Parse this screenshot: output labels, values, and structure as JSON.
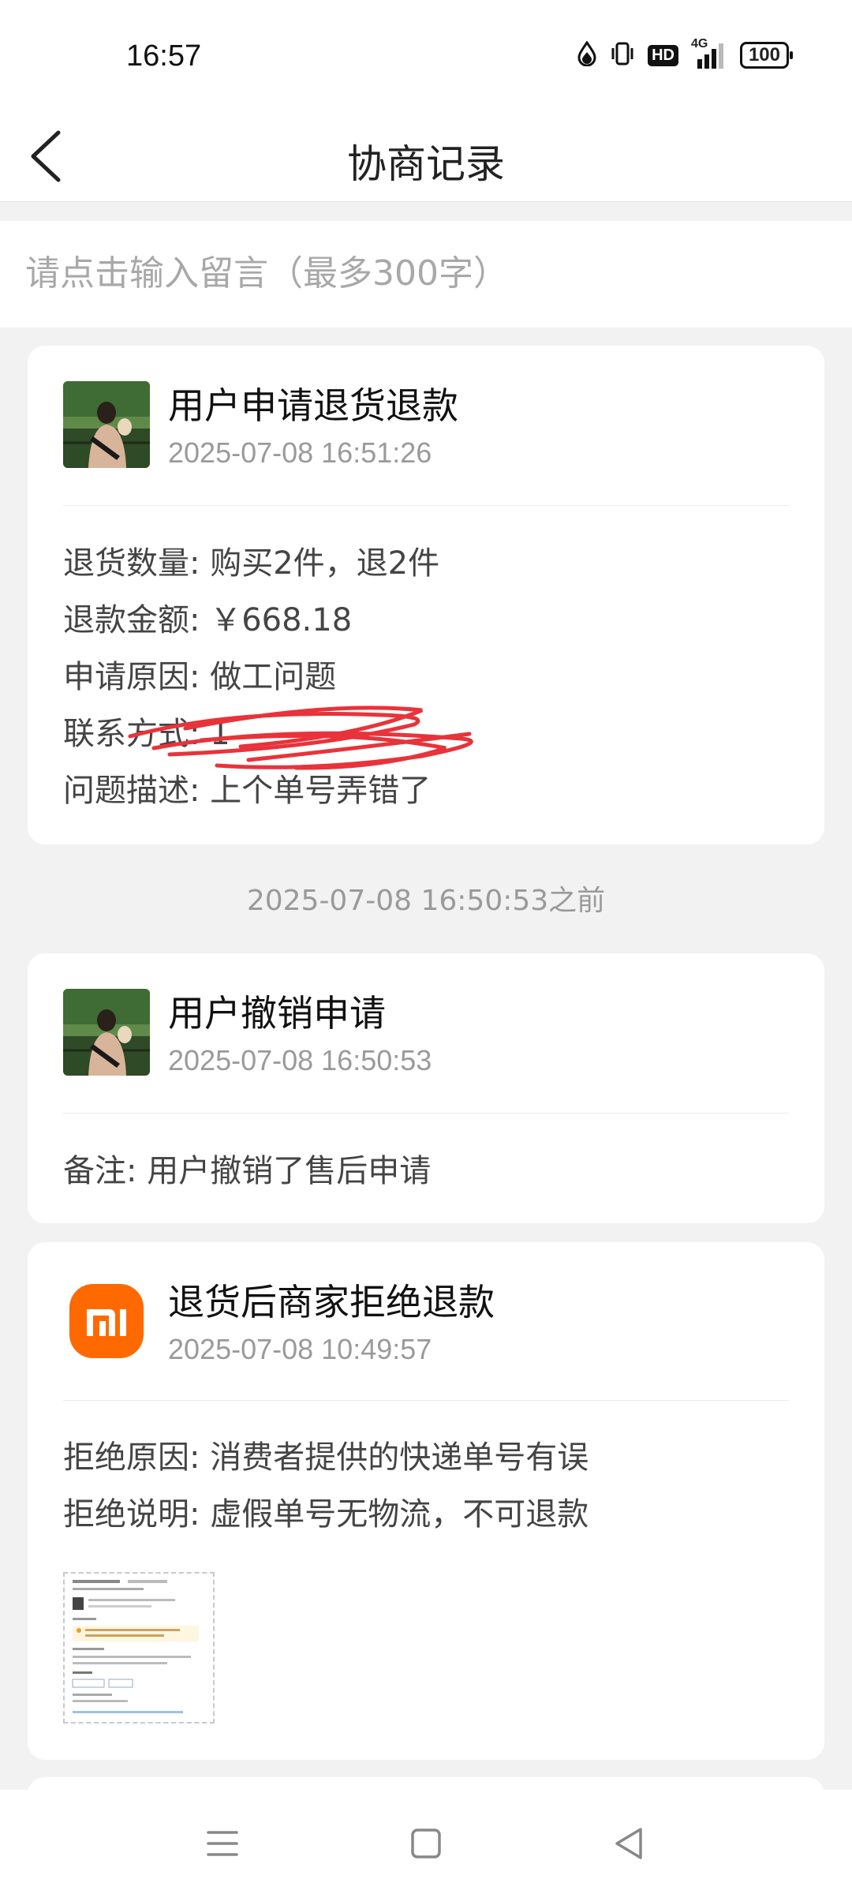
{
  "status_bar": {
    "time": "16:57",
    "network": "4G",
    "hd_label": "HD",
    "battery": "100",
    "icons": [
      "water-drop-icon",
      "vibrate-icon",
      "hd-icon",
      "signal-icon",
      "battery-icon"
    ]
  },
  "header": {
    "title": "协商记录",
    "back_icon": "back-arrow-icon"
  },
  "message_input": {
    "placeholder": "请点击输入留言（最多300字）"
  },
  "records": [
    {
      "title": "用户申请退货退款",
      "time": "2025-07-08 16:51:26",
      "avatar": "user-avatar",
      "fields": [
        "退货数量: 购买2件，退2件",
        "退款金额: ￥668.18",
        "申请原因: 做工问题",
        "联系方式: 1",
        "问题描述: 上个单号弄错了"
      ],
      "redaction": "red-scribble"
    },
    {
      "title": "用户撤销申请",
      "time": "2025-07-08 16:50:53",
      "avatar": "user-avatar",
      "fields": [
        "备注: 用户撤销了售后申请"
      ]
    },
    {
      "title": "退货后商家拒绝退款",
      "time": "2025-07-08 10:49:57",
      "avatar": "mi-logo",
      "fields": [
        "拒绝原因: 消费者提供的快递单号有误",
        "拒绝说明: 虚假单号无物流，不可退款"
      ],
      "attachment": "screenshot-thumbnail"
    }
  ],
  "separator_time": "2025-07-08 16:50:53之前",
  "colors": {
    "mi_orange": "#ff6900",
    "redaction_red": "#e8333a",
    "background": "#f2f2f2",
    "secondary_text": "#9a9a9a"
  },
  "nav_bar": {
    "buttons": [
      "menu-icon",
      "home-square-icon",
      "back-triangle-icon"
    ]
  }
}
